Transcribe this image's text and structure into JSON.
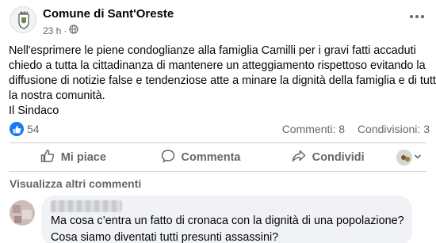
{
  "post": {
    "page_name": "Comune di Sant'Oreste",
    "time": "23 h",
    "separator": "·",
    "body_lines": [
      "Nell'esprimere le piene condoglianze alla famiglia Camilli per i gravi fatti accaduti",
      "chiedo a tutta la cittadinanza di mantenere un atteggiamento rispettoso evitando la",
      "diffusione di notizie false e tendenziose atte a minare la dignità della famiglia e di tutta",
      "la nostra comunità.",
      "Il Sindaco"
    ],
    "reactions_count": "54",
    "comments_count": "Commenti: 8",
    "shares_count": "Condivisioni: 3"
  },
  "actions": {
    "like_label": "Mi piace",
    "comment_label": "Commenta",
    "share_label": "Condividi"
  },
  "comments": {
    "view_more_label": "Visualizza altri commenti",
    "items": [
      {
        "author": "",
        "lines": [
          "Ma cosa c’entra un fatto di cronaca con la dignità di una popolazione?",
          "Cosa siamo diventati tutti presunti assassini?"
        ]
      }
    ]
  },
  "icons": {
    "globe": "globe-icon",
    "like": "thumbs-up-icon",
    "comment": "speech-bubble-icon",
    "share": "share-arrow-icon",
    "more": "more-dots-icon"
  },
  "colors": {
    "accent": "#1877f2",
    "secondary_text": "#65676b",
    "bubble": "#f0f2f5"
  }
}
